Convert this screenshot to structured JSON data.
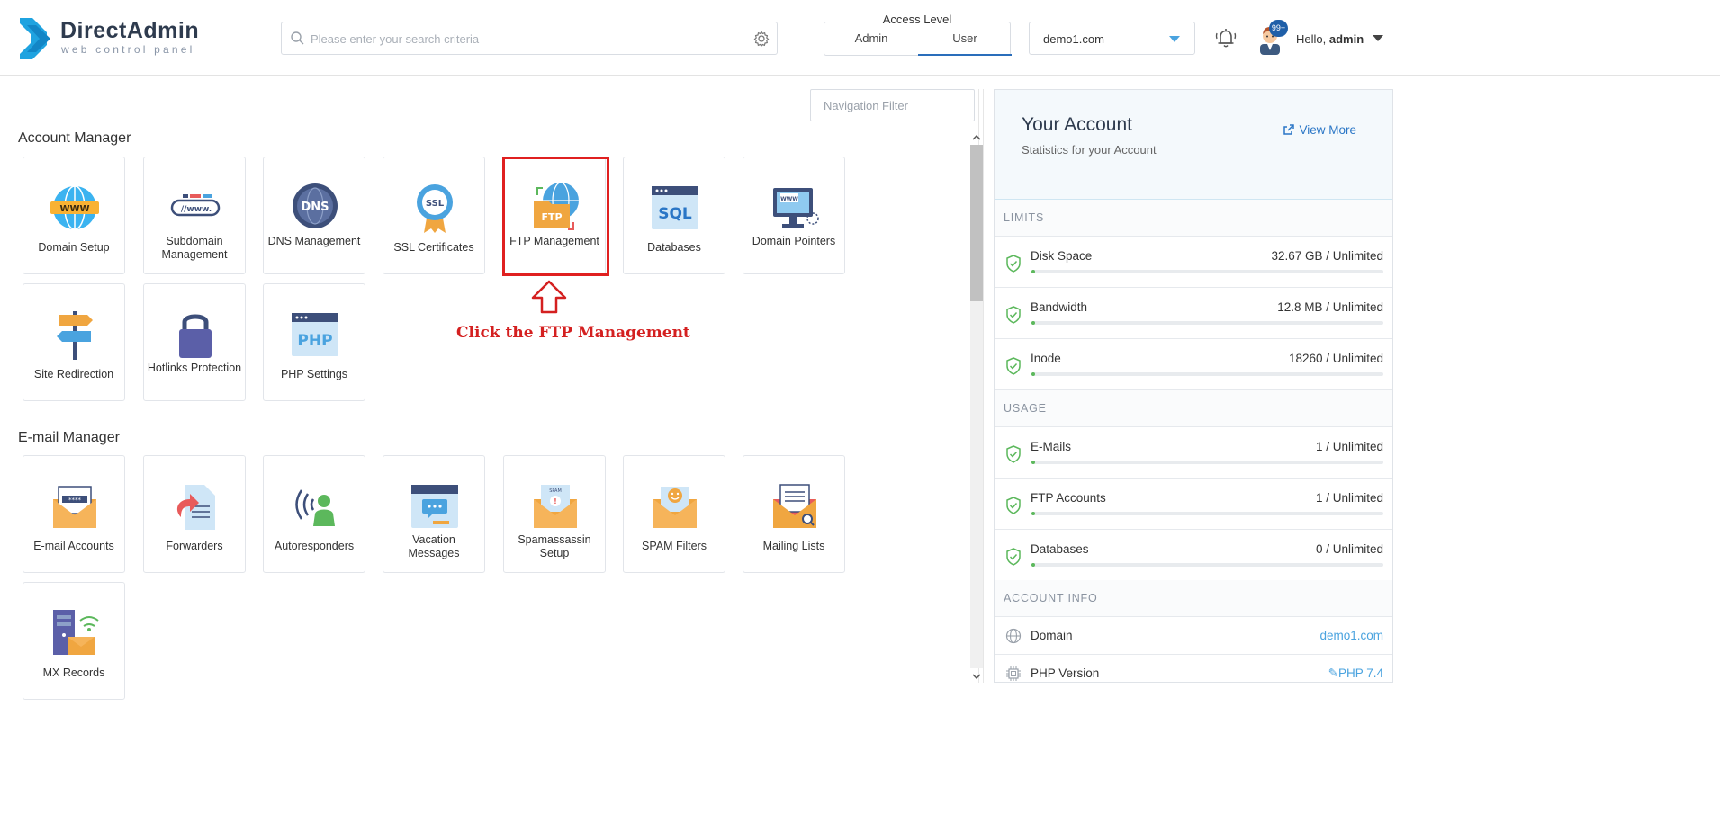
{
  "brand": {
    "name": "DirectAdmin",
    "tagline": "web control panel"
  },
  "header": {
    "search_placeholder": "Please enter your search criteria",
    "access_level": {
      "title": "Access Level",
      "options": [
        "Admin",
        "User"
      ],
      "selected": "User"
    },
    "domain": "demo1.com",
    "notification_badge": "99+",
    "greeting": "Hello,",
    "username": "admin"
  },
  "nav_filter_placeholder": "Navigation Filter",
  "account_manager": {
    "title": "Account Manager",
    "items": [
      {
        "label": "Domain Setup",
        "icon": "globe-www-icon"
      },
      {
        "label": "Subdomain Management",
        "icon": "subdomain-url-icon"
      },
      {
        "label": "DNS Management",
        "icon": "dns-globe-icon"
      },
      {
        "label": "SSL Certificates",
        "icon": "ssl-badge-icon"
      },
      {
        "label": "FTP Management",
        "icon": "ftp-folder-icon"
      },
      {
        "label": "Databases",
        "icon": "sql-window-icon"
      },
      {
        "label": "Domain Pointers",
        "icon": "monitor-www-icon"
      },
      {
        "label": "Site Redirection",
        "icon": "signpost-icon"
      },
      {
        "label": "Hotlinks Protection",
        "icon": "padlock-icon"
      },
      {
        "label": "PHP Settings",
        "icon": "php-window-icon"
      }
    ]
  },
  "email_manager": {
    "title": "E-mail Manager",
    "items": [
      {
        "label": "E-mail Accounts",
        "icon": "envelope-password-icon"
      },
      {
        "label": "Forwarders",
        "icon": "forward-document-icon"
      },
      {
        "label": "Autoresponders",
        "icon": "person-signal-icon"
      },
      {
        "label": "Vacation Messages",
        "icon": "chat-window-icon"
      },
      {
        "label": "Spamassassin Setup",
        "icon": "spam-envelope-icon"
      },
      {
        "label": "SPAM Filters",
        "icon": "smiley-envelope-icon"
      },
      {
        "label": "Mailing Lists",
        "icon": "list-envelope-icon"
      },
      {
        "label": "MX Records",
        "icon": "server-mail-icon"
      }
    ]
  },
  "annotation": {
    "callout": "Click the FTP Management",
    "target": "FTP Management"
  },
  "account": {
    "title": "Your Account",
    "subtitle": "Statistics for your Account",
    "view_more": "View More",
    "limits_title": "LIMITS",
    "limits": [
      {
        "name": "Disk Space",
        "value": "32.67 GB / Unlimited",
        "usage_fraction": 0.01
      },
      {
        "name": "Bandwidth",
        "value": "12.8 MB / Unlimited",
        "usage_fraction": 0.01
      },
      {
        "name": "Inode",
        "value": "18260 / Unlimited",
        "usage_fraction": 0.01
      }
    ],
    "usage_title": "USAGE",
    "usage": [
      {
        "name": "E-Mails",
        "value": "1 / Unlimited",
        "usage_fraction": 0.01
      },
      {
        "name": "FTP Accounts",
        "value": "1 / Unlimited",
        "usage_fraction": 0.01
      },
      {
        "name": "Databases",
        "value": "0 / Unlimited",
        "usage_fraction": 0.01
      }
    ],
    "info_title": "ACCOUNT INFO",
    "info": [
      {
        "name": "Domain",
        "value": "demo1.com",
        "icon": "globe-outline-icon"
      },
      {
        "name": "PHP Version",
        "value": "PHP 7.4",
        "icon": "chip-icon"
      }
    ]
  },
  "colors": {
    "accent": "#2a76c6",
    "brand": "#1fa3e0",
    "callout": "#d42020",
    "ok": "#5cb85c"
  }
}
